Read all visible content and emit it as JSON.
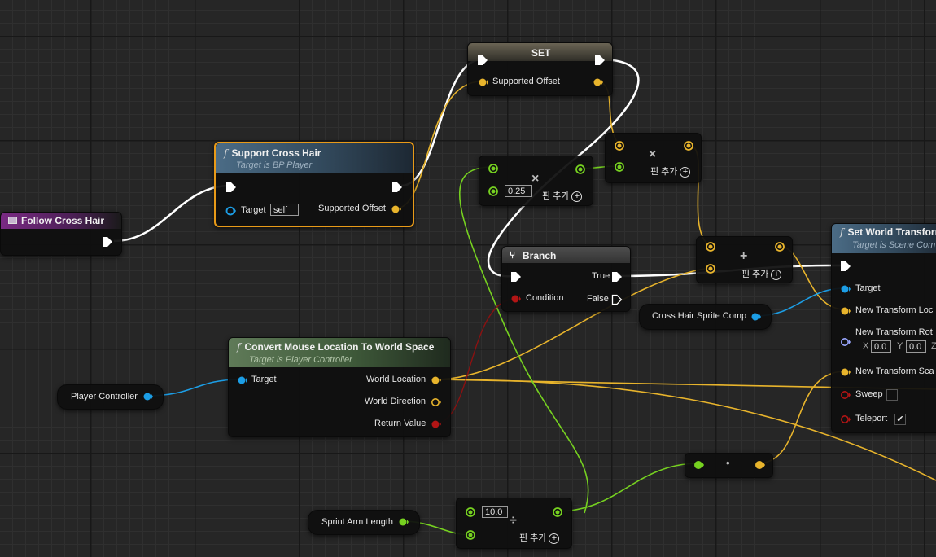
{
  "colors": {
    "exec": "#ffffff",
    "float_wire": "#76d120",
    "vector_wire": "#e8b42c",
    "object_wire": "#1c9ee6",
    "bool_wire": "#8b1111",
    "selected_outline": "#e89a18",
    "event_header": "#7a2a84",
    "function_header": "#4b6c86"
  },
  "nodes": {
    "follow_cross_hair": {
      "title": "Follow Cross Hair"
    },
    "support_cross_hair": {
      "title": "Support Cross Hair",
      "subtitle": "Target is BP Player",
      "target_label": "Target",
      "target_value": "self",
      "out_label": "Supported Offset"
    },
    "set_node": {
      "title": "SET",
      "pin_label": "Supported Offset"
    },
    "multiply_025": {
      "op": "×",
      "value": "0.25",
      "add_pin": "핀 추가"
    },
    "multiply_vec": {
      "op": "×",
      "add_pin": "핀 추가"
    },
    "add_vec": {
      "op": "+",
      "add_pin": "핀 추가"
    },
    "branch": {
      "title": "Branch",
      "condition": "Condition",
      "true_label": "True",
      "false_label": "False"
    },
    "convert_mouse": {
      "title": "Convert Mouse Location To World Space",
      "subtitle": "Target is Player Controller",
      "target_label": "Target",
      "out_world_location": "World Location",
      "out_world_direction": "World Direction",
      "out_return_value": "Return Value"
    },
    "player_controller": {
      "label": "Player Controller"
    },
    "cross_hair_sprite": {
      "label": "Cross Hair Sprite Comp"
    },
    "set_world_transform": {
      "title": "Set World Transform",
      "subtitle": "Target is Scene Com",
      "target_label": "Target",
      "loc_label": "New Transform Loc",
      "rot_label": "New Transform Rot",
      "rot_x_label": "X",
      "rot_x": "0.0",
      "rot_y_label": "Y",
      "rot_y": "0.0",
      "rot_z_label": "Z",
      "scale_label": "New Transform Sca",
      "sweep_label": "Sweep",
      "teleport_label": "Teleport",
      "teleport_checked": "✔"
    },
    "multiply_float": {
      "op": "•"
    },
    "divide_node": {
      "op": "÷",
      "value": "10.0",
      "add_pin": "핀 추가"
    },
    "sprint_arm_length": {
      "label": "Sprint Arm Length"
    }
  }
}
